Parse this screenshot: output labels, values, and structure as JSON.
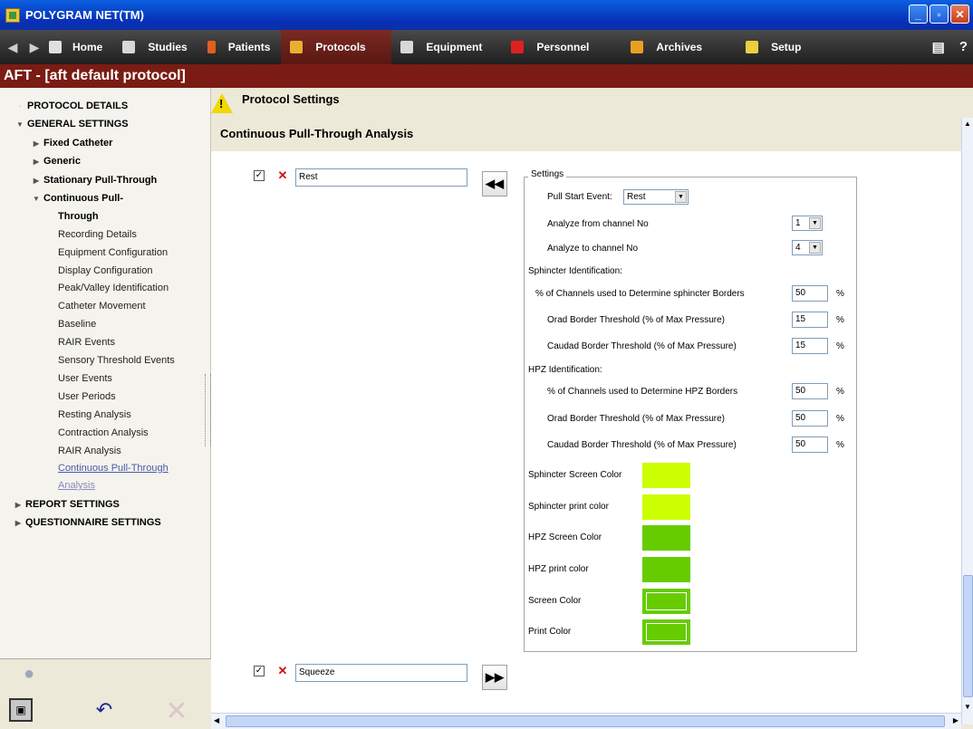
{
  "window": {
    "title": "POLYGRAM NET(TM)",
    "buttons": [
      "_",
      "▫",
      "✕"
    ]
  },
  "nav": {
    "items": [
      {
        "label": "Home",
        "color": "#e0e0e0"
      },
      {
        "label": "Studies",
        "color": "#d8d8d8"
      },
      {
        "label": "Patients",
        "color": "#e06020"
      },
      {
        "label": "Protocols",
        "color": "#e8b030"
      },
      {
        "label": "Equipment",
        "color": "#d8d8d8"
      },
      {
        "label": "Personnel",
        "color": "#e02020"
      },
      {
        "label": "Archives",
        "color": "#e8a020"
      },
      {
        "label": "Setup",
        "color": "#e8d040"
      }
    ],
    "active": "Protocols"
  },
  "header": {
    "title": "AFT - [aft default protocol]"
  },
  "sidebar": {
    "tree": [
      {
        "label": "PROTOCOL DETAILS",
        "type": "top",
        "arrow": ""
      },
      {
        "label": "GENERAL SETTINGS",
        "type": "top",
        "arrow": "▼"
      },
      {
        "label": "Fixed Catheter",
        "type": "group",
        "arrow": "▶"
      },
      {
        "label": "Generic",
        "type": "group",
        "arrow": "▶"
      },
      {
        "label": "Stationary Pull-Through",
        "type": "group",
        "arrow": "▶"
      },
      {
        "label": "Continuous Pull-",
        "type": "group",
        "arrow": "▼"
      },
      {
        "label": "Through",
        "type": "group",
        "arrow": ""
      }
    ],
    "children": [
      "Recording Details",
      "Equipment Configuration",
      "Display Configuration",
      "Peak/Valley Identification",
      "Catheter Movement",
      "Baseline",
      "RAIR Events",
      "Sensory Threshold Events",
      "User Events",
      "User Periods",
      "Resting Analysis",
      "Contraction Analysis",
      "RAIR Analysis",
      "Continuous Pull-Through",
      "Analysis"
    ],
    "bottom_sections": [
      "REPORT SETTINGS",
      "QUESTIONNAIRE SETTINGS"
    ]
  },
  "main": {
    "section_title": "Protocol Settings",
    "page_title": "Continuous Pull-Through Analysis",
    "events": [
      {
        "label": "Rest",
        "checked": "✓",
        "remove": "✕",
        "arrow": "◀◀"
      },
      {
        "label": "Squeeze",
        "checked": "✓",
        "remove": "✕",
        "arrow": "▶▶"
      }
    ],
    "settings": {
      "legend": "Settings",
      "pull_start_label": "Pull Start Event:",
      "pull_start_value": "Rest",
      "analyze_from_label": "Analyze from channel No",
      "analyze_from_value": "1",
      "analyze_to_label": "Analyze to channel No",
      "analyze_to_value": "4",
      "sphincter_title": "Sphincter Identification:",
      "sph_channels_label": "% of Channels used to Determine sphincter Borders",
      "sph_channels_value": "50",
      "sph_orad_label": "Orad Border Threshold (% of Max Pressure)",
      "sph_orad_value": "15",
      "sph_caudad_label": "Caudad Border Threshold (% of Max Pressure)",
      "sph_caudad_value": "15",
      "hpz_title": "HPZ Identification:",
      "hpz_channels_label": "% of Channels used to Determine HPZ Borders",
      "hpz_channels_value": "50",
      "hpz_orad_label": "Orad Border Threshold (% of Max Pressure)",
      "hpz_orad_value": "50",
      "hpz_caudad_label": "Caudad Border Threshold (% of Max Pressure)",
      "hpz_caudad_value": "50",
      "percent": "%",
      "colors": [
        {
          "label": "Sphincter Screen Color",
          "color": "#ccff00"
        },
        {
          "label": "Sphincter print color",
          "color": "#ccff00"
        },
        {
          "label": "HPZ Screen Color",
          "color": "#66cc00"
        },
        {
          "label": "HPZ print color",
          "color": "#66cc00"
        },
        {
          "label": "Screen Color",
          "color": "#66cc00"
        },
        {
          "label": "Print Color",
          "color": "#66cc00"
        }
      ]
    }
  }
}
